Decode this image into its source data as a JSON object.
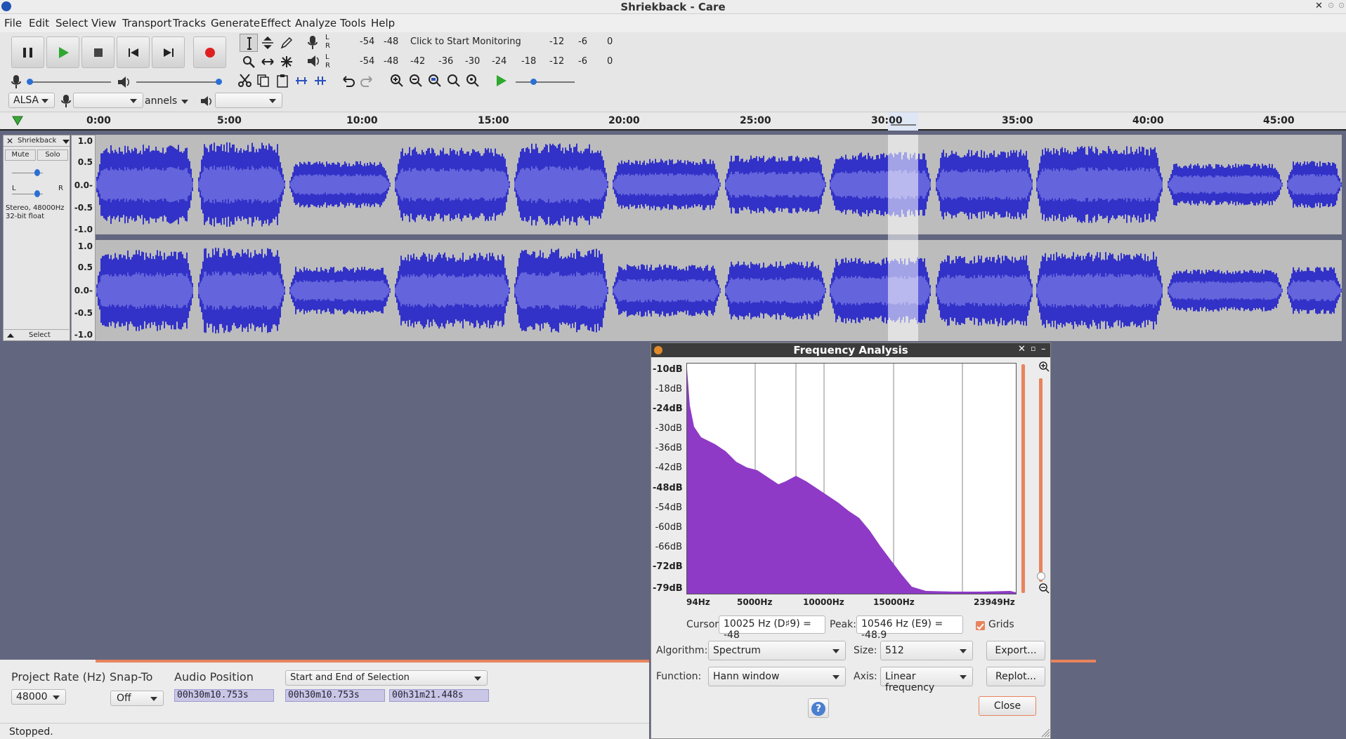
{
  "window": {
    "title": "Shriekback - Care"
  },
  "menu": [
    "File",
    "Edit",
    "Select",
    "View",
    "Transport",
    "Tracks",
    "Generate",
    "Effect",
    "Analyze",
    "Tools",
    "Help"
  ],
  "meters": {
    "record_label": "Click to Start Monitoring",
    "record_scale": [
      "-54",
      "-48",
      "-12",
      "-6",
      "0"
    ],
    "play_scale": [
      "-54",
      "-48",
      "-42",
      "-36",
      "-30",
      "-24",
      "-18",
      "-12",
      "-6",
      "0"
    ],
    "lr": [
      "L",
      "R"
    ]
  },
  "device": {
    "host": "ALSA",
    "input_channels": "annels"
  },
  "ruler": {
    "ticks": [
      "0:00",
      "5:00",
      "10:00",
      "15:00",
      "20:00",
      "25:00",
      "30:00",
      "35:00",
      "40:00",
      "45:00"
    ]
  },
  "track": {
    "name": "Shriekback",
    "mute": "Mute",
    "solo": "Solo",
    "pan_l": "L",
    "pan_r": "R",
    "info_line1": "Stereo, 48000Hz",
    "info_line2": "32-bit float",
    "select": "Select",
    "axis": [
      "1.0",
      "0.5",
      "0.0-",
      "-0.5",
      "-1.0"
    ]
  },
  "bottom": {
    "project_rate_label": "Project Rate (Hz)",
    "project_rate_value": "48000",
    "snap_label": "Snap-To",
    "snap_value": "Off",
    "audio_pos_label": "Audio Position",
    "selection_mode": "Start and End of Selection",
    "audio_pos_value": "00h30m10.753s",
    "sel_start": "00h30m10.753s",
    "sel_end": "00h31m21.448s",
    "status": "Stopped."
  },
  "dialog": {
    "title": "Frequency Analysis",
    "db_labels": [
      "-10dB",
      "-18dB",
      "-24dB",
      "-30dB",
      "-36dB",
      "-42dB",
      "-48dB",
      "-54dB",
      "-60dB",
      "-66dB",
      "-72dB",
      "-79dB"
    ],
    "hz_labels": [
      "94Hz",
      "5000Hz",
      "10000Hz",
      "15000Hz",
      "23949Hz"
    ],
    "cursor_label": "Cursor:",
    "cursor_value": "10025 Hz (D♯9) = -48",
    "peak_label": "Peak:",
    "peak_value": "10546 Hz (E9) = -48.9",
    "grids_label": "Grids",
    "grids_checked": true,
    "algorithm_label": "Algorithm:",
    "algorithm_value": "Spectrum",
    "size_label": "Size:",
    "size_value": "512",
    "export_label": "Export...",
    "function_label": "Function:",
    "function_value": "Hann window",
    "axis_label": "Axis:",
    "axis_value": "Linear frequency",
    "replot_label": "Replot...",
    "help_label": "?",
    "close_label": "Close"
  },
  "colors": {
    "waveform": "#3232c8",
    "waveform_rms": "#6464dc",
    "spectrum": "#8e3ac6",
    "background": "#62667f",
    "selection_bar": "#e8835d"
  }
}
